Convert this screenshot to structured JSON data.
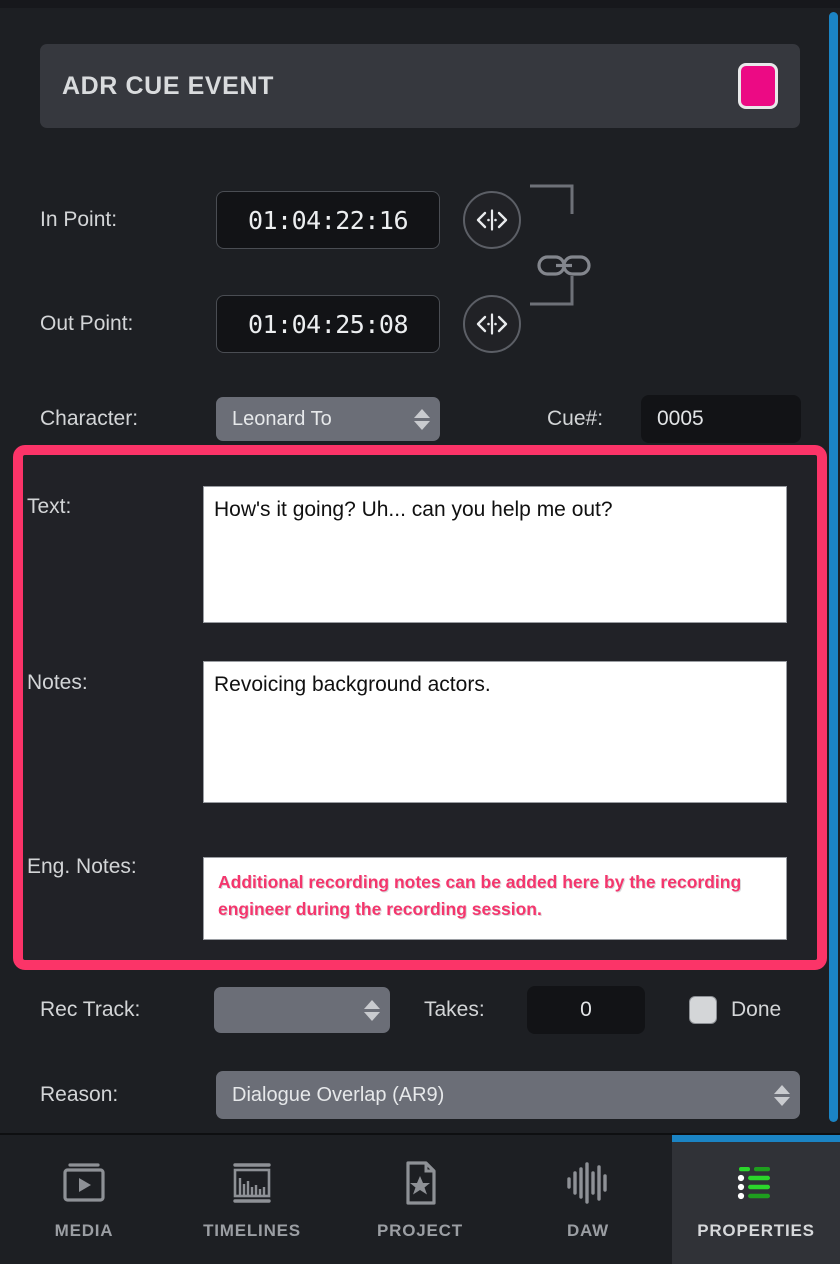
{
  "header": {
    "title": "ADR CUE EVENT",
    "swatch_color": "#ec0a84",
    "swatch_name": "cue-color-swatch"
  },
  "fields": {
    "in_point": {
      "label": "In Point:",
      "value": "01:04:22:16"
    },
    "out_point": {
      "label": "Out Point:",
      "value": "01:04:25:08"
    },
    "character": {
      "label": "Character:",
      "value": "Leonard To"
    },
    "cue_number": {
      "label": "Cue#:",
      "value": "0005"
    },
    "text": {
      "label": "Text:",
      "value": "How's it going? Uh... can you help me out?"
    },
    "notes": {
      "label": "Notes:",
      "value": "Revoicing background actors."
    },
    "eng_notes": {
      "label": "Eng. Notes:",
      "value": "Additional recording notes can be added here by the recording engineer during the recording session.",
      "text_color": "#f4366d"
    },
    "rec_track": {
      "label": "Rec Track:",
      "value": ""
    },
    "takes": {
      "label": "Takes:",
      "value": "0"
    },
    "done": {
      "label": "Done",
      "checked": false
    },
    "reason": {
      "label": "Reason:",
      "value": "Dialogue Overlap (AR9)"
    }
  },
  "highlight": {
    "color": "#fb3468"
  },
  "scrollbar": {
    "color": "#1b84c4"
  },
  "nav": {
    "items": [
      {
        "label": "MEDIA",
        "icon": "media-play-box-icon",
        "active": false
      },
      {
        "label": "TIMELINES",
        "icon": "timeline-ruler-icon",
        "active": false
      },
      {
        "label": "PROJECT",
        "icon": "project-star-document-icon",
        "active": false
      },
      {
        "label": "DAW",
        "icon": "daw-waveform-icon",
        "active": false
      },
      {
        "label": "PROPERTIES",
        "icon": "properties-list-icon",
        "active": true
      }
    ],
    "active_indicator_color": "#1b84c4"
  },
  "icons": {
    "nudge": "nudge-inout-icon",
    "link": "link-chain-icon",
    "spinner": "spinner-updown-icon"
  }
}
